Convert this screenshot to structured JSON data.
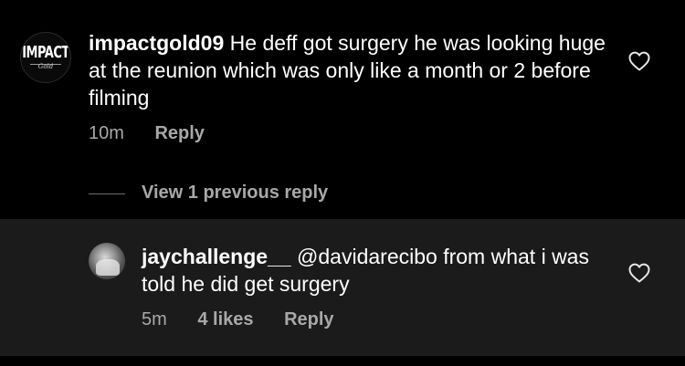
{
  "comment": {
    "avatar_logo": "IMPACT",
    "avatar_logo_sub": "Gold",
    "username": "impactgold09",
    "text": "He deff got surgery he was looking huge at the reunion which was only like a month or 2 before filming",
    "time": "10m",
    "reply_label": "Reply",
    "heart_icon": "heart-outline-icon"
  },
  "view_previous": {
    "label": "View 1 previous reply"
  },
  "reply": {
    "username": "jaychallenge__",
    "text": "@davidarecibo from what i was told he did get surgery",
    "time": "5m",
    "likes": "4 likes",
    "reply_label": "Reply",
    "heart_icon": "heart-outline-icon"
  },
  "colors": {
    "background": "#000000",
    "reply_background": "#1b1b1b",
    "text": "#ffffff",
    "secondary_text": "#a8a8a8"
  }
}
